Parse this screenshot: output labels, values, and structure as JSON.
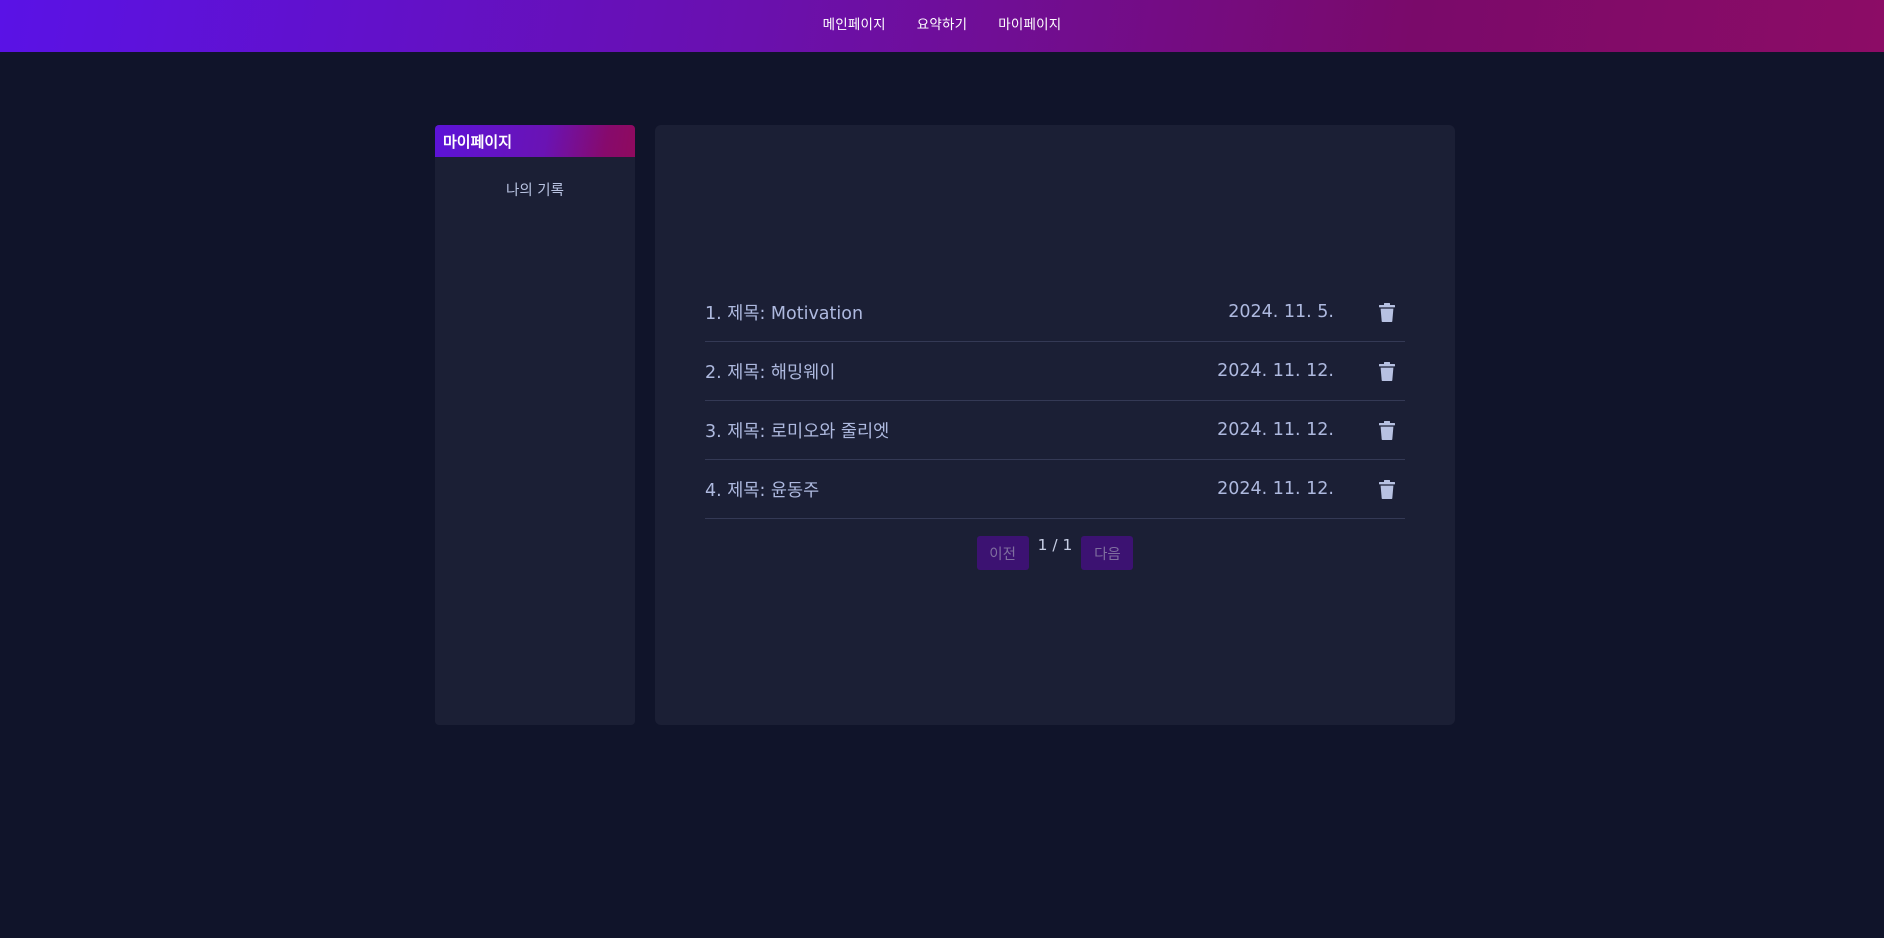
{
  "nav": {
    "items": [
      "메인페이지",
      "요약하기",
      "마이페이지"
    ]
  },
  "sidebar": {
    "title": "마이페이지",
    "items": [
      {
        "label": "나의 기록"
      }
    ]
  },
  "records": [
    {
      "title": "1. 제목: Motivation",
      "date": "2024. 11. 5."
    },
    {
      "title": "2. 제목: 해밍웨이",
      "date": "2024. 11. 12."
    },
    {
      "title": "3. 제목: 로미오와 줄리엣",
      "date": "2024. 11. 12."
    },
    {
      "title": "4. 제목: 윤동주",
      "date": "2024. 11. 12."
    }
  ],
  "pagination": {
    "prev_label": "이전",
    "page_info": "1 / 1",
    "next_label": "다음"
  },
  "icons": {
    "delete": "trash-icon"
  },
  "colors": {
    "background": "#10142a",
    "panel": "#1b1f35",
    "accent_start": "#5a12e6",
    "accent_end": "#8c0c66",
    "button": "#3c1272"
  }
}
